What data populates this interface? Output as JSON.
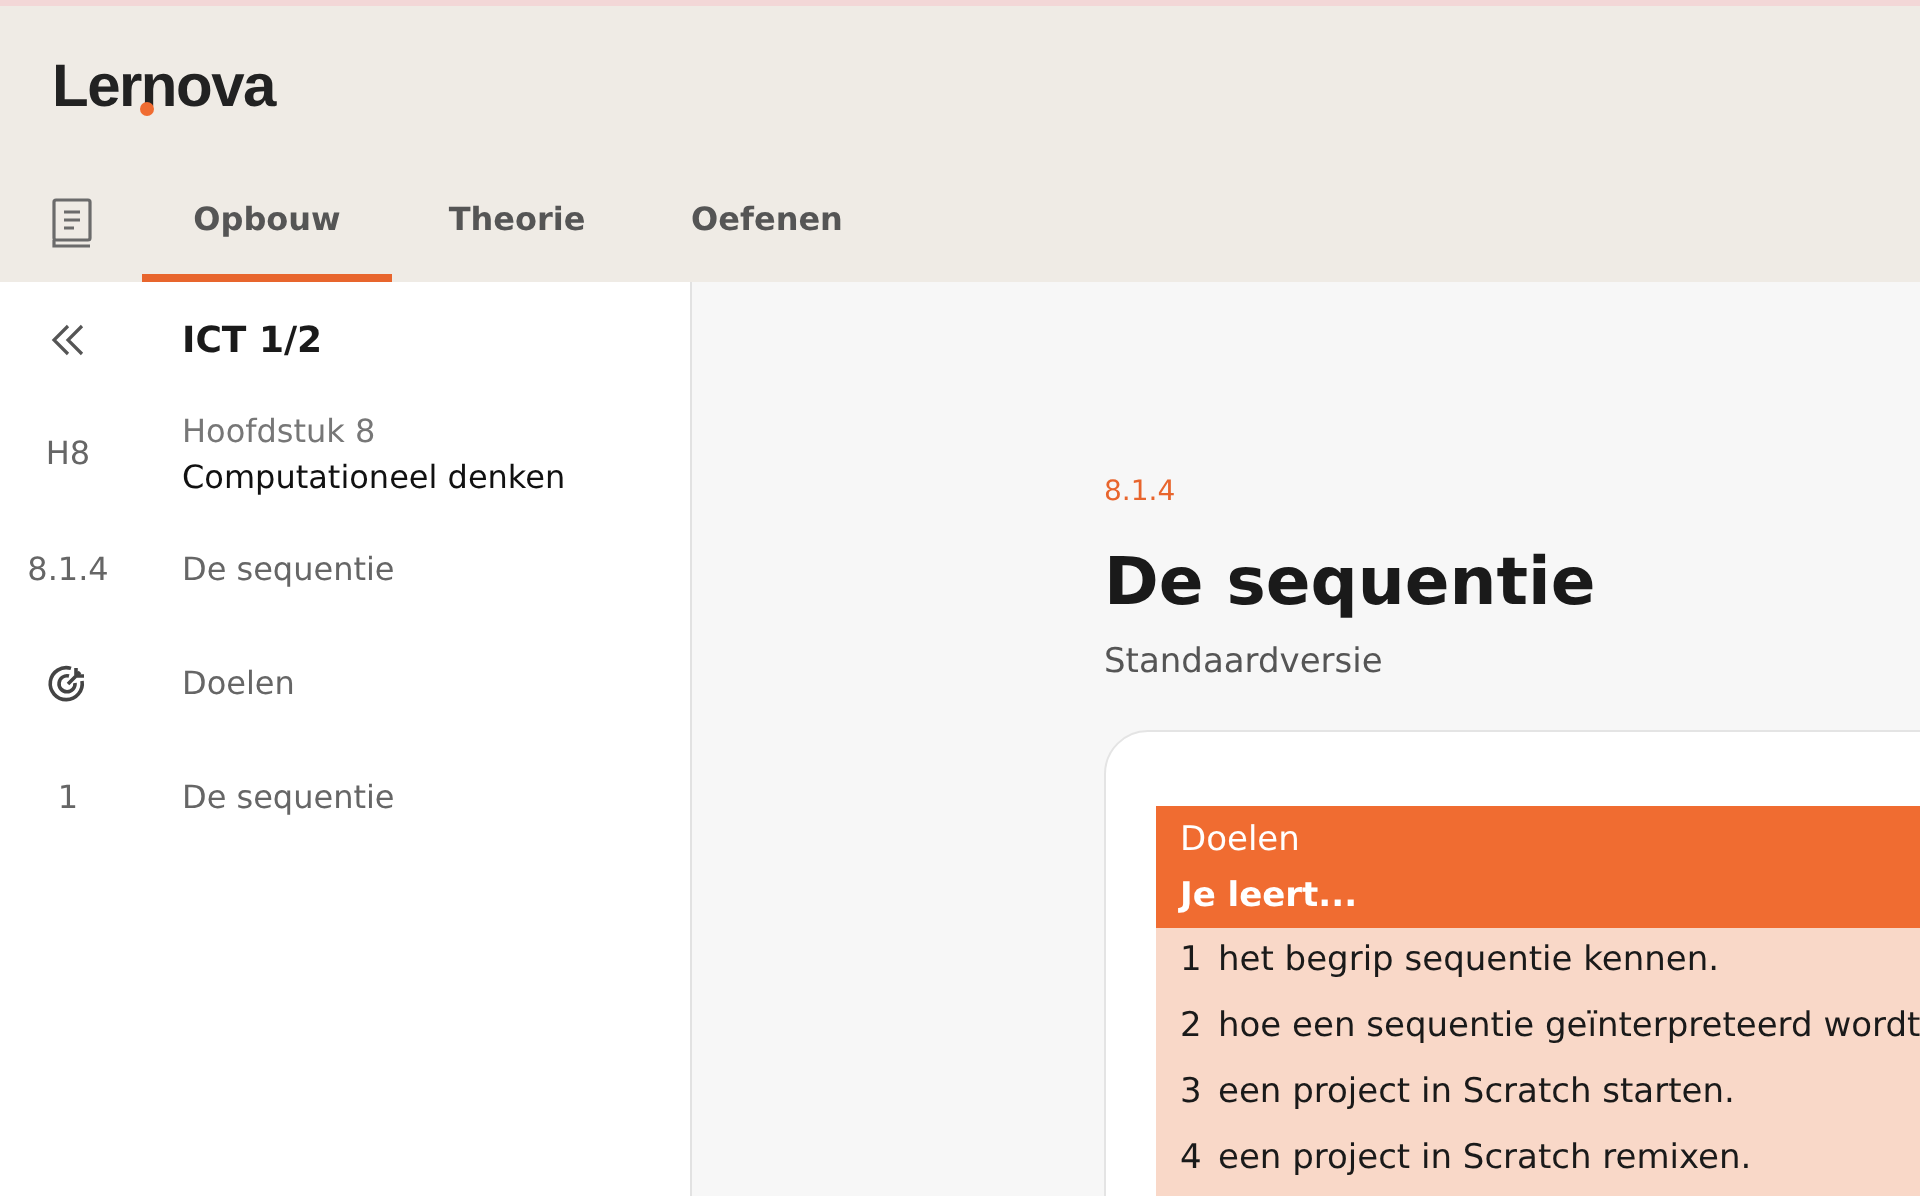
{
  "logo": {
    "text": "Lernova"
  },
  "tabs": [
    {
      "label": "Opbouw",
      "selected": true
    },
    {
      "label": "Theorie",
      "selected": false
    },
    {
      "label": "Oefenen",
      "selected": false
    }
  ],
  "sidebar": {
    "items": [
      {
        "kind": "collapse",
        "title": "ICT 1/2"
      },
      {
        "kind": "chapter",
        "marker": "H8",
        "subtitle": "Hoofdstuk 8",
        "title": "Computationeel denken"
      },
      {
        "kind": "entry",
        "marker": "8.1.4",
        "title": "De sequentie"
      },
      {
        "kind": "goals",
        "title": "Doelen"
      },
      {
        "kind": "entry",
        "marker": "1",
        "title": "De sequentie"
      }
    ]
  },
  "content": {
    "section_number": "8.1.4",
    "title": "De sequentie",
    "version": "Standaardversie",
    "goals_box": {
      "heading": "Doelen",
      "subheading": "Je leert...",
      "items": [
        {
          "number": "1",
          "text": "het begrip sequentie kennen."
        },
        {
          "number": "2",
          "text": "hoe een sequentie geïnterpreteerd wordt"
        },
        {
          "number": "3",
          "text": "een project in Scratch starten."
        },
        {
          "number": "4",
          "text": "een project in Scratch remixen."
        }
      ]
    }
  }
}
